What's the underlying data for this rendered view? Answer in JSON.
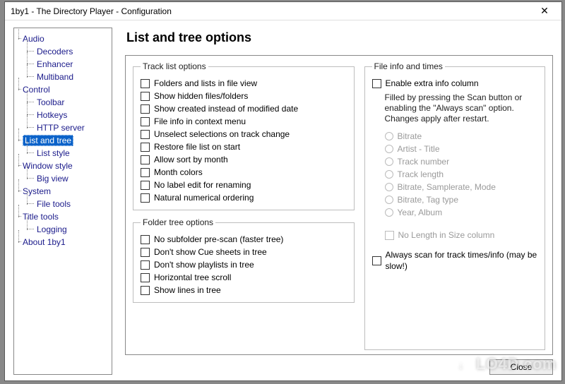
{
  "window": {
    "title": "1by1 - The Directory Player - Configuration",
    "close_glyph": "✕"
  },
  "sidebar": {
    "groups": [
      {
        "label": "Audio",
        "children": [
          "Decoders",
          "Enhancer",
          "Multiband"
        ]
      },
      {
        "label": "Control",
        "children": [
          "Toolbar",
          "Hotkeys",
          "HTTP server"
        ]
      },
      {
        "label": "List and tree",
        "selected": true,
        "children": [
          "List style"
        ]
      },
      {
        "label": "Window style",
        "children": [
          "Big view"
        ]
      },
      {
        "label": "System",
        "children": [
          "File tools"
        ]
      },
      {
        "label": "Title tools",
        "children": [
          "Logging"
        ]
      },
      {
        "label": "About 1by1",
        "children": []
      }
    ]
  },
  "page": {
    "title": "List and tree options",
    "track_list": {
      "legend": "Track list options",
      "items": [
        "Folders and lists in file view",
        "Show hidden files/folders",
        "Show created instead of modified date",
        "File info in context menu",
        "Unselect selections on track change",
        "Restore file list on start",
        "Allow sort by month",
        "Month colors",
        "No label edit for renaming",
        "Natural numerical ordering"
      ]
    },
    "folder_tree": {
      "legend": "Folder tree options",
      "items": [
        "No subfolder pre-scan (faster tree)",
        "Don't show Cue sheets in tree",
        "Don't show playlists in tree",
        "Horizontal tree scroll",
        "Show lines in tree"
      ]
    },
    "file_info": {
      "legend": "File info and times",
      "enable_label": "Enable extra info column",
      "hint": "Filled by pressing the Scan button or enabling the \"Always scan\" option. Changes apply after restart.",
      "radios": [
        "Bitrate",
        "Artist - Title",
        "Track number",
        "Track length",
        "Bitrate, Samplerate, Mode",
        "Bitrate, Tag type",
        "Year, Album"
      ],
      "no_length_label": "No Length in Size column",
      "always_scan_label": "Always scan for track times/info (may be slow!)"
    }
  },
  "footer": {
    "close_label": "Close"
  },
  "watermark": "LO4D.com"
}
